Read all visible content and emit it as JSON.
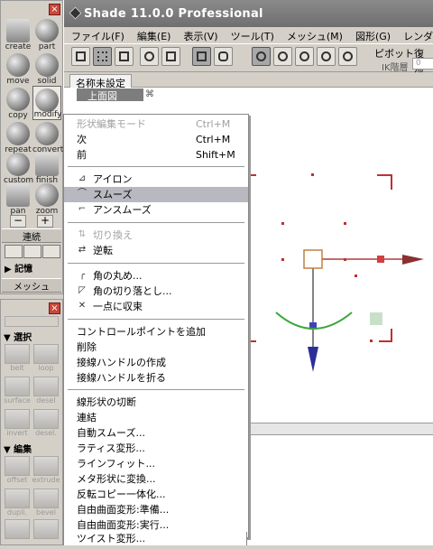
{
  "app": {
    "title": "Shade 11.0.0 Professional"
  },
  "menubar": [
    "ファイル(F)",
    "編集(E)",
    "表示(V)",
    "ツール(T)",
    "メッシュ(M)",
    "図形(G)",
    "レンダリング"
  ],
  "toolbar": {
    "pivot": "ピボット",
    "fukki": "復帰",
    "ik_label": "IK階層",
    "ik_value": "0"
  },
  "document": {
    "tab": "名称未設定",
    "view_title": "上面図"
  },
  "palette_top": {
    "close": "×",
    "tools": [
      {
        "label": "create",
        "icon": "create-icon"
      },
      {
        "label": "part",
        "icon": "part-icon"
      },
      {
        "label": "move",
        "icon": "move-icon"
      },
      {
        "label": "solid",
        "icon": "solid-icon"
      },
      {
        "label": "copy",
        "icon": "copy-icon"
      },
      {
        "label": "modify",
        "icon": "modify-icon"
      },
      {
        "label": "repeat",
        "icon": "repeat-icon"
      },
      {
        "label": "convert",
        "icon": "convert-icon"
      },
      {
        "label": "custom",
        "icon": "custom-icon"
      },
      {
        "label": "finish",
        "icon": "finish-icon"
      },
      {
        "label": "pan",
        "icon": "pan-icon"
      },
      {
        "label": "zoom",
        "icon": "zoom-icon"
      }
    ],
    "minus": "−",
    "plus": "+",
    "renketsu": "連続",
    "kioku": "▶ 記憶",
    "mesh": "メッシュ"
  },
  "palette_bottom": {
    "close": "×",
    "section_select": "▼ 選択",
    "section_edit": "▼ 編集",
    "select_tools": [
      "belt",
      "loop",
      "surface",
      "deseI",
      "invert",
      "desel."
    ],
    "edit_tools": [
      "offset",
      "extrude",
      "dupli.",
      "bevel"
    ]
  },
  "context_menu": {
    "items": [
      {
        "label": "形状編集モード",
        "shortcut": "Ctrl+M",
        "disabled": true
      },
      {
        "label": "次",
        "shortcut": "Ctrl+M"
      },
      {
        "label": "前",
        "shortcut": "Shift+M"
      },
      {
        "label": "アイロン",
        "icon": "iron-icon"
      },
      {
        "label": "スムーズ",
        "icon": "smooth-icon",
        "highlighted": true
      },
      {
        "label": "アンスムーズ",
        "icon": "unsmooth-icon"
      },
      {
        "label": "切り換え",
        "icon": "switch-icon",
        "disabled": true
      },
      {
        "label": "逆転",
        "icon": "reverse-icon"
      },
      {
        "label": "角の丸め...",
        "icon": "round-corner-icon"
      },
      {
        "label": "角の切り落とし...",
        "icon": "chamfer-icon"
      },
      {
        "label": "一点に収束",
        "icon": "converge-icon"
      },
      {
        "label": "コントロールポイントを追加"
      },
      {
        "label": "削除"
      },
      {
        "label": "接線ハンドルの作成"
      },
      {
        "label": "接線ハンドルを折る"
      },
      {
        "label": "線形状の切断"
      },
      {
        "label": "連結"
      },
      {
        "label": "自動スムーズ..."
      },
      {
        "label": "ラティス変形..."
      },
      {
        "label": "ラインフィット..."
      },
      {
        "label": "メタ形状に変換..."
      },
      {
        "label": "反転コピー一体化..."
      },
      {
        "label": "自由曲面変形:準備..."
      },
      {
        "label": "自由曲面変形:実行..."
      },
      {
        "label": "ツイスト変形..."
      }
    ]
  },
  "colors": {
    "accent": "#2d2d9a",
    "axis_red": "#c03030",
    "green": "#3aa83a",
    "selection": "#b8b8c0"
  }
}
